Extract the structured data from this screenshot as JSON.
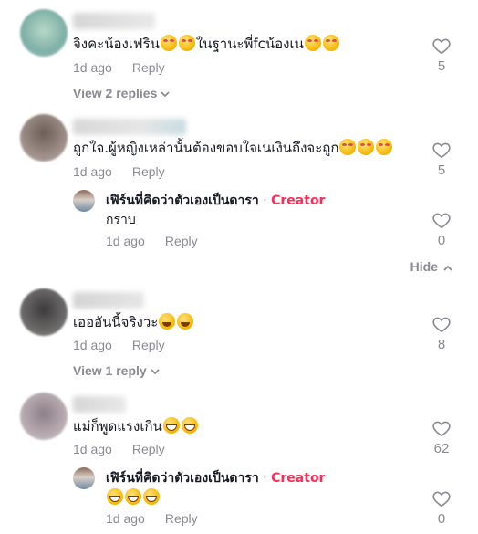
{
  "comments": [
    {
      "text": "จิงคะน้องเฟริน",
      "text_suffix": "ในฐานะพี่fcน้องเน",
      "time": "1d ago",
      "reply_label": "Reply",
      "likes": "5",
      "view_replies": "View 2 replies",
      "avatar_color": "#9fc7c0"
    },
    {
      "text": "ถูกใจ.ผู้หญิงเหล่านั้นต้องขอบใจเนเงินถึงจะถูก",
      "time": "1d ago",
      "reply_label": "Reply",
      "likes": "5",
      "avatar_color": "#8a7d78",
      "reply": {
        "name": "เฟิร์นที่คิดว่าตัวเองเป็นดารา",
        "separator": "·",
        "tag": "Creator",
        "text": "กราบ",
        "time": "1d ago",
        "reply_label": "Reply",
        "likes": "0"
      },
      "hide_label": "Hide"
    },
    {
      "text": "เอออันนี้จริงวะ",
      "time": "1d ago",
      "reply_label": "Reply",
      "likes": "8",
      "view_replies": "View 1 reply",
      "avatar_color": "#5c5a5a"
    },
    {
      "text": "แม่ก็พูดแรงเกิน",
      "time": "1d ago",
      "reply_label": "Reply",
      "likes": "62",
      "avatar_color": "#a79aa0",
      "reply": {
        "name": "เฟิร์นที่คิดว่าตัวเองเป็นดารา",
        "separator": "·",
        "tag": "Creator",
        "time": "1d ago",
        "reply_label": "Reply",
        "likes": "0"
      }
    }
  ],
  "colors": {
    "creator_tag": "#fe2c55",
    "meta": "#8a8b91",
    "text": "#161823"
  }
}
